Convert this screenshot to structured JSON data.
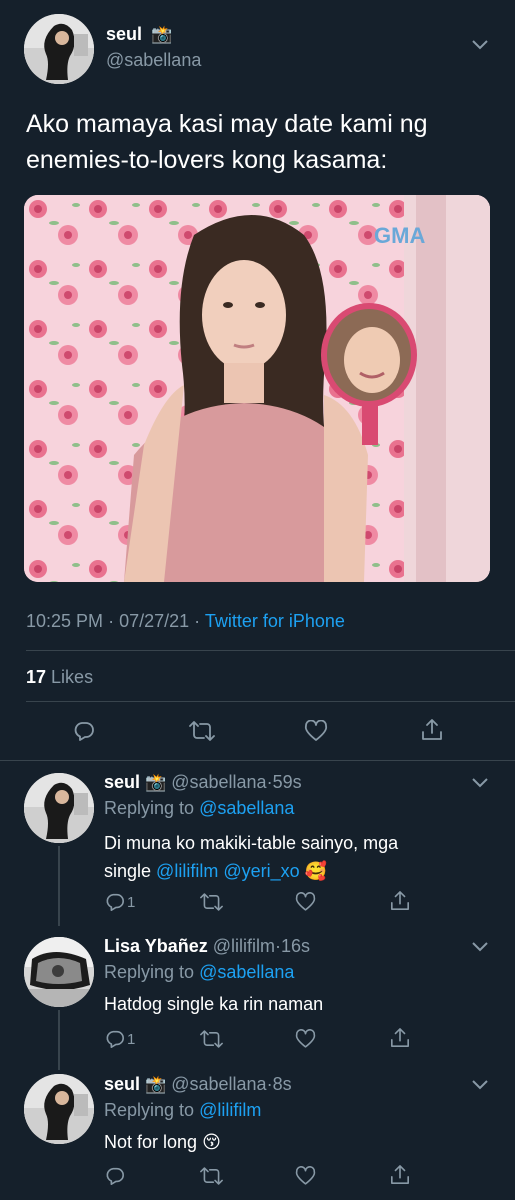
{
  "main_tweet": {
    "author_name": "seul",
    "author_emoji": "📸",
    "handle": "@sabellana",
    "text_line1": "Ako mamaya kasi may date kami ng",
    "text_line2": "enemies-to-lovers kong kasama:",
    "image_watermark": "GMA",
    "time": "10:25 PM",
    "date": "07/27/21",
    "source": "Twitter for iPhone",
    "separator": "·",
    "likes_count": "17",
    "likes_label": "Likes"
  },
  "replies": [
    {
      "name": "seul",
      "emoji": "📸",
      "handle": "@sabellana",
      "time": "59s",
      "replying_label": "Replying to",
      "replying_to": "@sabellana",
      "text_line1": "Di muna ko makiki-table sainyo, mga",
      "text_prefix": "single",
      "mention1": "@lilifilm",
      "mention2": "@yeri_xo",
      "text_emoji": "🥰",
      "reply_count": "1"
    },
    {
      "name": "Lisa Ybañez",
      "handle": "@lilifilm",
      "time": "16s",
      "replying_label": "Replying to",
      "replying_to": "@sabellana",
      "text": "Hatdog single ka rin naman",
      "reply_count": "1"
    },
    {
      "name": "seul",
      "emoji": "📸",
      "handle": "@sabellana",
      "time": "8s",
      "replying_label": "Replying to",
      "replying_to": "@lilifilm",
      "text": "Not for long",
      "text_emoji": "😚"
    }
  ],
  "colors": {
    "background": "#15202b",
    "accent": "#1da1f2",
    "muted": "#8899a6",
    "divider": "#38444d"
  }
}
